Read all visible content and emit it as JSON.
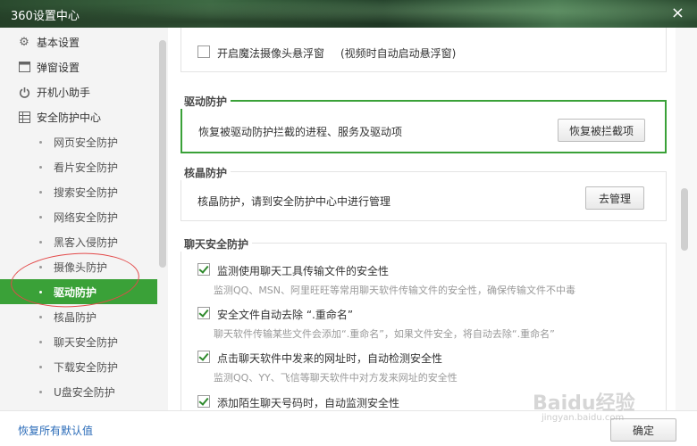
{
  "window": {
    "title": "360设置中心",
    "close_glyph": "×"
  },
  "sidebar": {
    "main_items": [
      {
        "label": "基本设置",
        "icon": "gear-icon"
      },
      {
        "label": "弹窗设置",
        "icon": "window-icon"
      },
      {
        "label": "开机小助手",
        "icon": "power-icon"
      },
      {
        "label": "安全防护中心",
        "icon": "grid-icon"
      }
    ],
    "sub_items": [
      {
        "label": "网页安全防护"
      },
      {
        "label": "看片安全防护"
      },
      {
        "label": "搜索安全防护"
      },
      {
        "label": "网络安全防护"
      },
      {
        "label": "黑客入侵防护"
      },
      {
        "label": "摄像头防护"
      },
      {
        "label": "驱动防护",
        "active": true
      },
      {
        "label": "核晶防护"
      },
      {
        "label": "聊天安全防护"
      },
      {
        "label": "下载安全防护"
      },
      {
        "label": "U盘安全防护"
      }
    ]
  },
  "sections": {
    "camera": {
      "checkbox_label": "开启魔法摄像头悬浮窗",
      "note": "(视频时自动启动悬浮窗)"
    },
    "driver": {
      "title": "驱动防护",
      "desc": "恢复被驱动防护拦截的进程、服务及驱动项",
      "button": "恢复被拦截项"
    },
    "kernel": {
      "title": "核晶防护",
      "desc": "核晶防护，请到安全防护中心中进行管理",
      "button": "去管理"
    },
    "chat": {
      "title": "聊天安全防护",
      "items": [
        {
          "label": "监测使用聊天工具传输文件的安全性",
          "desc": "监测QQ、MSN、阿里旺旺等常用聊天软件传输文件的安全性，确保传输文件不中毒",
          "checked": true
        },
        {
          "label": "安全文件自动去除 “.重命名”",
          "desc": "聊天软件传输某些文件会添加“.重命名”，如果文件安全，将自动去除“.重命名”",
          "checked": true
        },
        {
          "label": "点击聊天软件中发来的网址时，自动检测安全性",
          "desc": "监测QQ、YY、飞信等聊天软件中对方发来网址的安全性",
          "checked": true
        },
        {
          "label": "添加陌生聊天号码时，自动监测安全性",
          "desc": "",
          "checked": true
        }
      ]
    }
  },
  "footer": {
    "restore_link": "恢复所有默认值",
    "ok_button": "确定"
  },
  "watermark": {
    "text": "Baidu经验",
    "sub": "jingyan.baidu.com"
  },
  "colors": {
    "accent_green": "#3aa138",
    "link_blue": "#2a6bb8",
    "annotation_red": "#e34a4a"
  }
}
